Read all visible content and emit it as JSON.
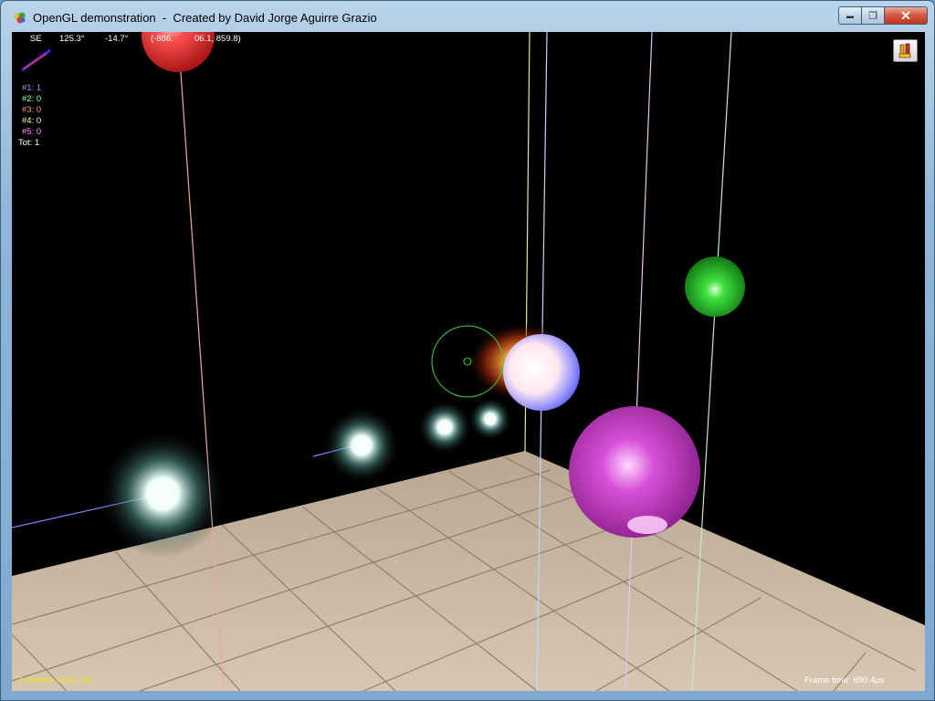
{
  "window": {
    "title": "OpenGL demonstration  -  Created by David Jorge Aguirre Grazio",
    "buttons": {
      "minimize": "▬",
      "maximize": "❐",
      "close": "✕"
    }
  },
  "hud": {
    "camera": {
      "direction": "SE",
      "yaw": "125.3°",
      "pitch": "-14.7°",
      "position": "(-886.",
      "position_hidden_mid": "06.1, 859.8)"
    },
    "counters": [
      {
        "label": "#1: 1",
        "color": "#9a9aff"
      },
      {
        "label": "#2: 0",
        "color": "#a8ffa8"
      },
      {
        "label": "#3: 0",
        "color": "#ff9a8a"
      },
      {
        "label": "#4: 0",
        "color": "#ffffa0"
      },
      {
        "label": "#5: 0",
        "color": "#ff9aff"
      }
    ],
    "total": "Tot: 1",
    "available_shots": "Available shots: 98",
    "frame_time": "Frame time: 690.4µs"
  },
  "colors": {
    "shots_text": "#f0e020",
    "floor_tile": "#c9b7a1",
    "ball_red": "#ff4040",
    "ball_green": "#22cc22",
    "ball_magenta": "#d040d0",
    "ball_blue": "#6060ff"
  },
  "icons": {
    "app": "opengl-app-icon",
    "tool": "toolbox-icon"
  }
}
